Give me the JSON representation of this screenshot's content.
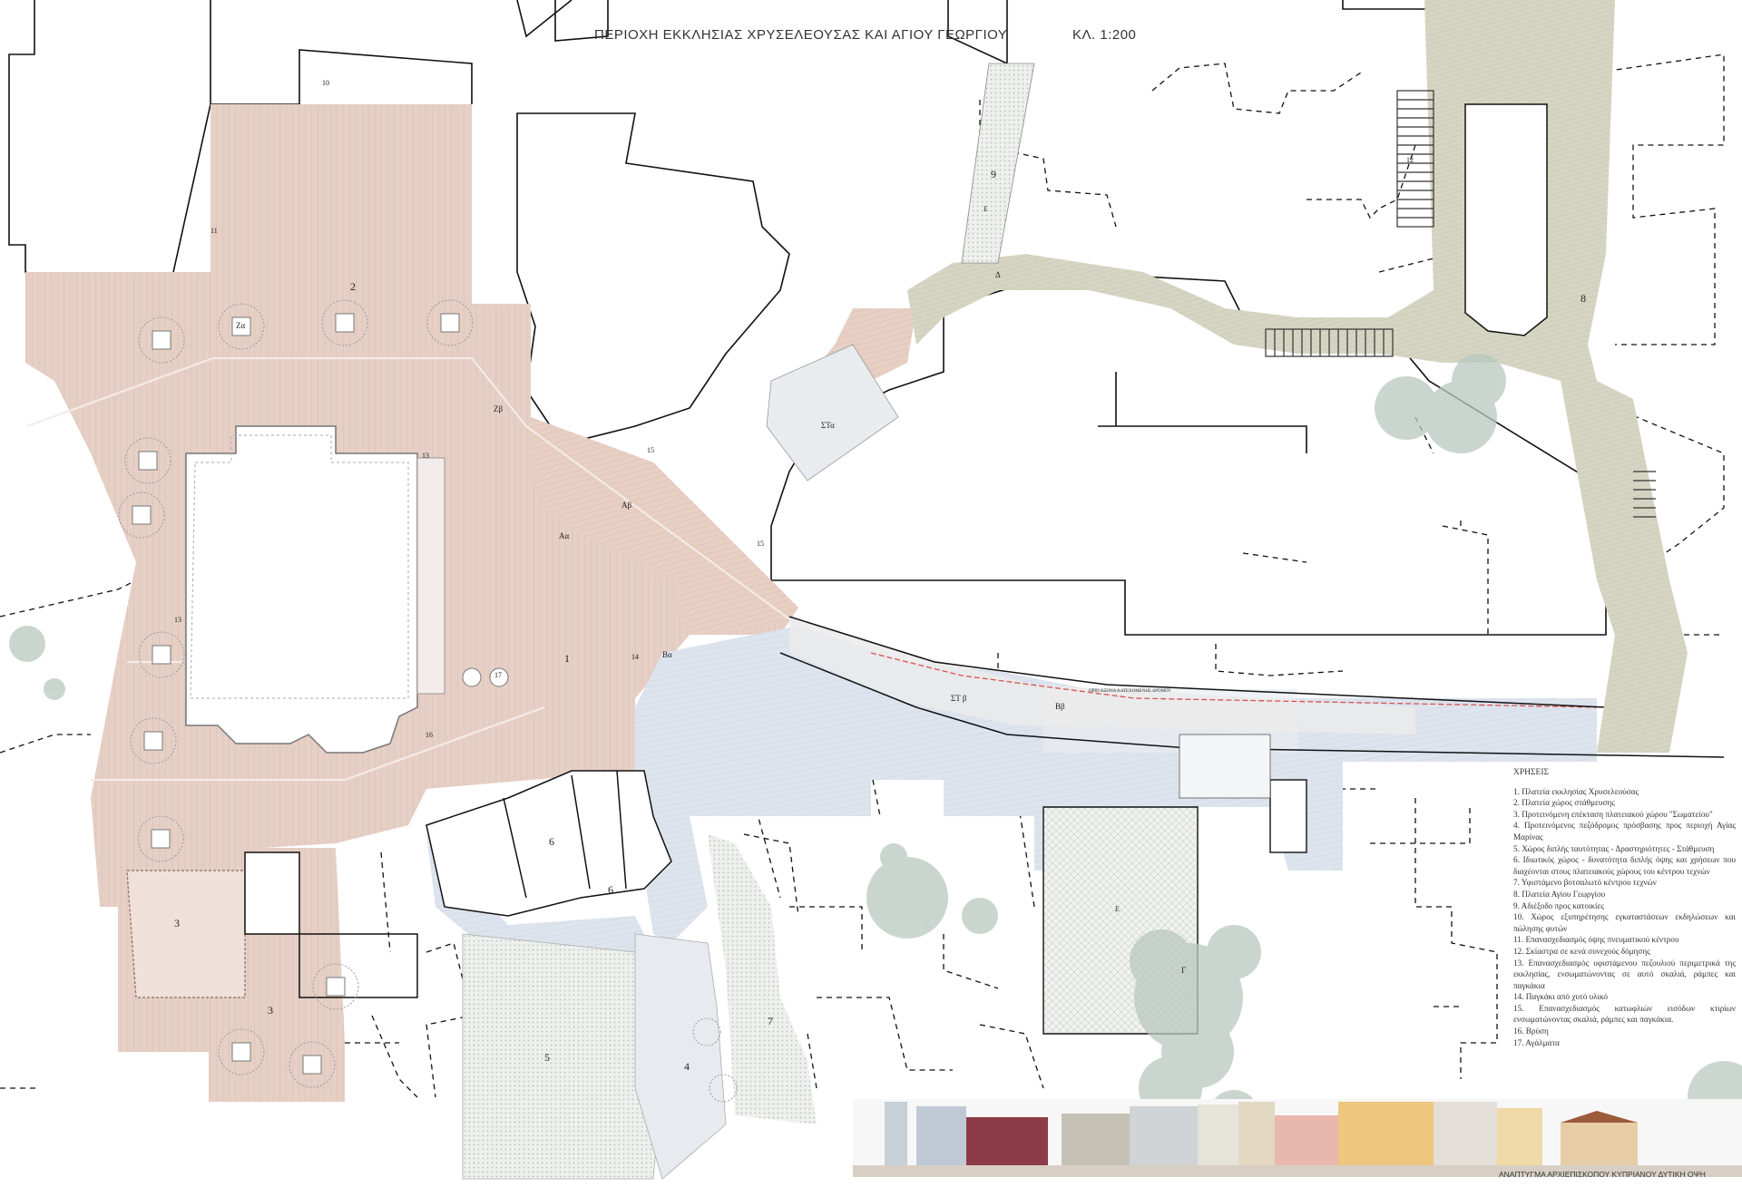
{
  "title": "ΠΕΡΙΟΧΗ ΕΚΚΛΗΣΙΑΣ ΧΡΥΣΕΛΕΟΥΣΑΣ ΚΑΙ ΑΓΙΟΥ ΓΕΩΡΓΙΟΥ",
  "scale": "ΚΛ. 1:200",
  "colors": {
    "church_square": "#e7cfc4",
    "square_2": "#e8d3c9",
    "blue_road": "#dce3ee",
    "green_path": "#d4d3c0",
    "trees": "#b9c8c0",
    "paving_light": "#e6e6e6",
    "road_axis": "#d9534f"
  },
  "zone_labels": {
    "z1": "1",
    "z2": "2",
    "z3a": "3",
    "z3b": "3",
    "z4": "4",
    "z5": "5",
    "z6a": "6",
    "z6b": "6",
    "z7": "7",
    "z8": "8",
    "z9": "9",
    "z10": "10",
    "z11": "11",
    "z12": "12",
    "z13a": "13",
    "z13b": "13",
    "z14": "14",
    "z15a": "15",
    "z15b": "15",
    "z16": "16",
    "z17": "17",
    "Aa": "Αα",
    "Ab": "Αβ",
    "Ba": "Βα",
    "Bb": "Ββ",
    "G": "Γ",
    "D": "Δ",
    "E1": "Ε",
    "E2": "Ε",
    "STa": "ΣΤα",
    "STb": "ΣΤ β",
    "Za": "Ζα",
    "Zb": "Ζβ"
  },
  "road_axis_label": "ΟΡΙΟ ΑΞΟΝΑ ΚΑΤΕΧΟΜΕΝΗΣ ΔΡΟΜΟΥ",
  "legend": {
    "heading": "ΧΡΗΣΕΙΣ",
    "items": [
      "1. Πλατεία εκκλησίας Χρυσελεούσας",
      "2. Πλατεία χώρος στάθμευσης",
      "3. Προτεινόμενη επέκταση πλατειακού χώρου \"Σωματείου\"",
      "4. Προτεινόμενος πεζόδρομος πρόσβασης προς περιοχή Αγίας Μαρίνας",
      "5. Χώρος διπλής ταυτότητας - Δραστηριότητες - Στάθμευση",
      "6. Ιδιωτικός χώρος - δυνατότητα διπλής όψης και χρήσεων που διαχέονται στους πλατειακούς χώρους του κέντρου τεχνών",
      "7. Υφιστάμενο βοτσαλωτό κέντρου τεχνών",
      "8. Πλατεία Αγίου Γεωργίου",
      "9. Αδιέξοδο προς κατοικίες",
      "10. Χώρος εξυπηρέτησης εγκαταστάσεων εκδηλώσεων και πώλησης φυτών",
      "11. Επανασχεδιασμός όψης πνευματικού κέντρου",
      "12. Σκίαστρα σε κενά συνεχούς δόμησης",
      "13. Επανασχεδιασμός υφιστάμενου πεζουλιού περιμετρικά της εκκλησίας, ενσωματώνοντας σε αυτό σκαλιά, ράμπες και παγκάκια",
      "14. Παγκάκι από χυτό υλικό",
      "15. Επανασχεδιασμός κατωφλιών εισόδων κτιρίων ενσωματώνοντας σκαλιά, ράμπες και παγκάκια.",
      "16. Βρύση",
      "17. Αγάλματα"
    ]
  },
  "elevation_caption": "ΑΝΑΠΤΥΓΜΑ ΑΡΧΙΕΠΙΣΚΟΠΟΥ ΚΥΠΡΙΑΝΟΥ ΔΥΤΙΚΗ ΟΨΗ"
}
